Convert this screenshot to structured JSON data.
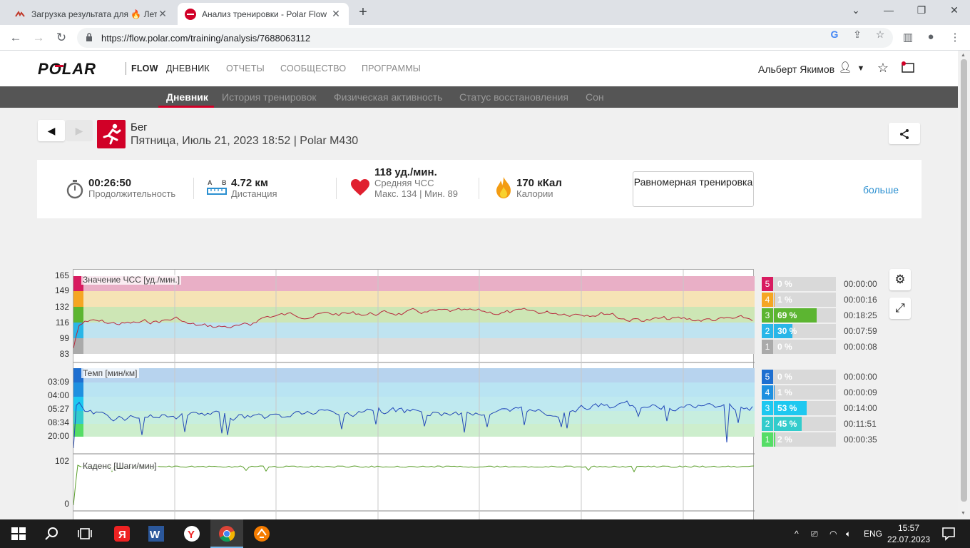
{
  "browser": {
    "tabs": [
      {
        "title": "Загрузка результата для 🔥 Лето",
        "active": false
      },
      {
        "title": "Анализ тренировки - Polar Flow",
        "active": true
      }
    ],
    "url": "https://flow.polar.com/training/analysis/7688063112"
  },
  "header": {
    "brand": "FLOW",
    "nav": [
      "ДНЕВНИК",
      "ОТЧЕТЫ",
      "СООБЩЕСТВО",
      "ПРОГРАММЫ"
    ],
    "active_nav": "ДНЕВНИК",
    "user_name": "Альберт Якимов"
  },
  "subnav": {
    "items": [
      "Дневник",
      "История тренировок",
      "Физическая активность",
      "Статус восстановления",
      "Сон"
    ],
    "active": "Дневник"
  },
  "session": {
    "sport": "Бег",
    "datetime": "Пятница, Июль 21, 2023 18:52 | Polar M430"
  },
  "summary": {
    "duration_value": "00:26:50",
    "duration_label": "Продолжительность",
    "distance_value": "4.72 км",
    "distance_label": "Дистанция",
    "hr_value": "118 уд./мин.",
    "hr_label": "Средняя ЧСС",
    "hr_minmax": "Макс. 134 | Мин. 89",
    "calories_value": "170 кКал",
    "calories_label": "Калории",
    "training_type": "Равномерная тренировка",
    "more_link": "больше"
  },
  "charts": {
    "hr": {
      "label": "Значение ЧСС [уд./мин.]",
      "ticks": [
        "165",
        "149",
        "132",
        "116",
        "99",
        "83"
      ],
      "zones": [
        {
          "num": "5",
          "pct": "0 %",
          "fraction": 0.0,
          "time": "00:00:00",
          "color": "#d81b60"
        },
        {
          "num": "4",
          "pct": "1 %",
          "fraction": 0.01,
          "time": "00:00:16",
          "color": "#f5a623"
        },
        {
          "num": "3",
          "pct": "69 %",
          "fraction": 0.69,
          "time": "00:18:25",
          "color": "#5cb531"
        },
        {
          "num": "2",
          "pct": "30 %",
          "fraction": 0.3,
          "time": "00:07:59",
          "color": "#29b6e8"
        },
        {
          "num": "1",
          "pct": "0 %",
          "fraction": 0.0,
          "time": "00:00:08",
          "color": "#aaaaaa"
        }
      ]
    },
    "pace": {
      "label": "Темп [мин/км]",
      "ticks": [
        "03:09",
        "04:00",
        "05:27",
        "08:34",
        "20:00"
      ],
      "zones": [
        {
          "num": "5",
          "pct": "0 %",
          "fraction": 0.0,
          "time": "00:00:00",
          "color": "#1e6fd0"
        },
        {
          "num": "4",
          "pct": "1 %",
          "fraction": 0.01,
          "time": "00:00:09",
          "color": "#1e90e0"
        },
        {
          "num": "3",
          "pct": "53 %",
          "fraction": 0.53,
          "time": "00:14:00",
          "color": "#1ec8f0"
        },
        {
          "num": "2",
          "pct": "45 %",
          "fraction": 0.45,
          "time": "00:11:51",
          "color": "#33cccc"
        },
        {
          "num": "1",
          "pct": "2 %",
          "fraction": 0.02,
          "time": "00:00:35",
          "color": "#55dd66"
        }
      ]
    },
    "cadence": {
      "label": "Каденс [Шаги/мин]",
      "ticks": [
        "102",
        "0"
      ]
    }
  },
  "taskbar": {
    "lang": "ENG",
    "time": "15:57",
    "date": "22.07.2023"
  }
}
